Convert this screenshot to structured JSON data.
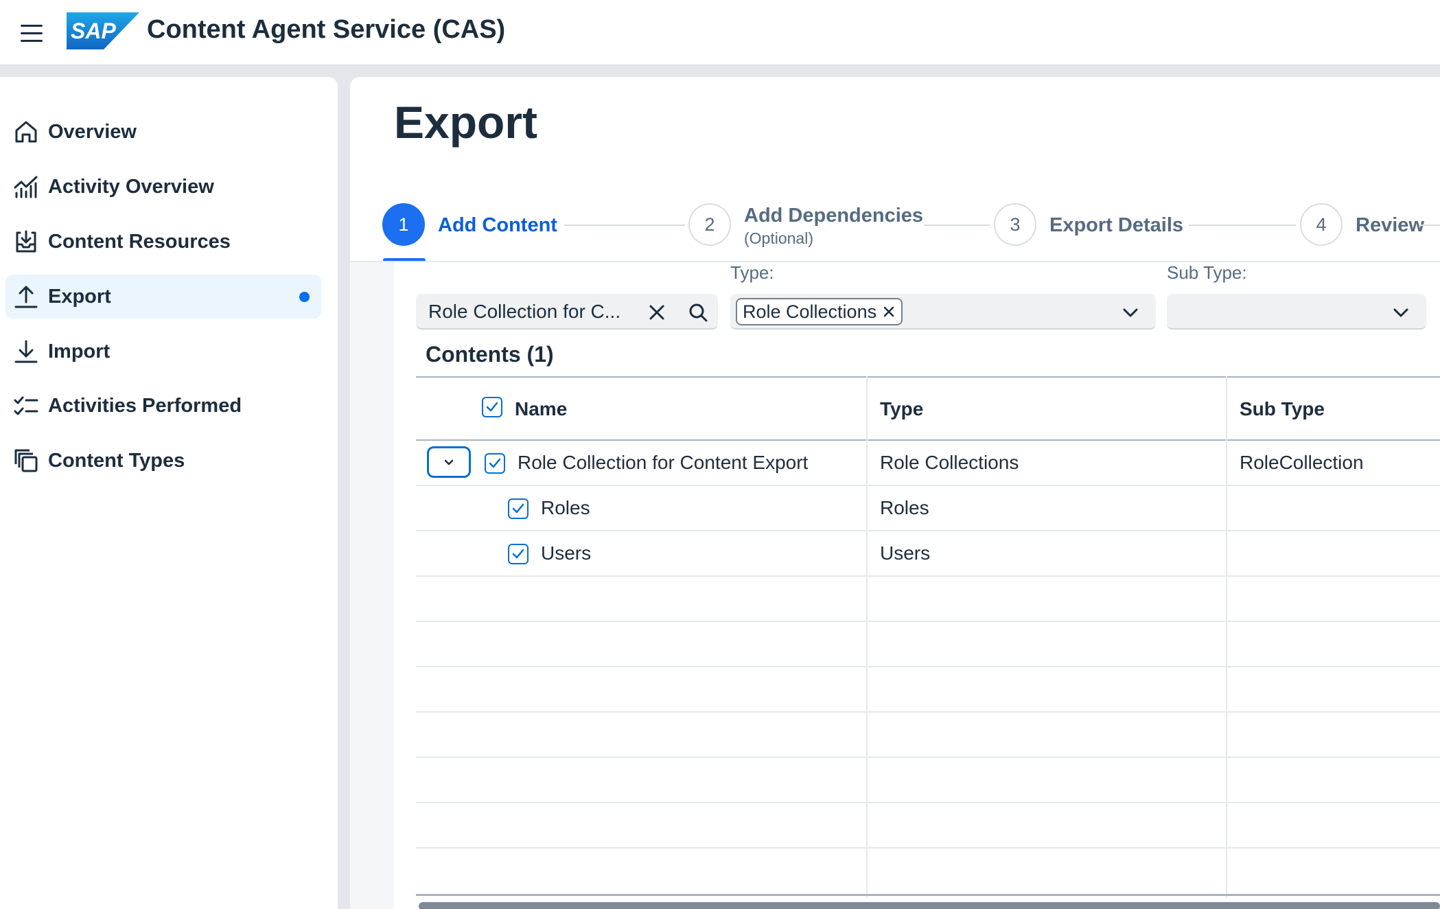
{
  "shell": {
    "title": "Content Agent Service (CAS)",
    "logo_text": "SAP"
  },
  "nav": {
    "items": [
      {
        "label": "Overview",
        "icon": "home-icon"
      },
      {
        "label": "Activity Overview",
        "icon": "activity-chart-icon"
      },
      {
        "label": "Content Resources",
        "icon": "inbox-download-icon"
      },
      {
        "label": "Export",
        "icon": "upload-icon",
        "selected": true
      },
      {
        "label": "Import",
        "icon": "download-icon"
      },
      {
        "label": "Activities Performed",
        "icon": "task-list-icon"
      },
      {
        "label": "Content Types",
        "icon": "stacked-pages-icon"
      }
    ]
  },
  "page": {
    "title": "Export"
  },
  "wizard": {
    "steps": [
      {
        "number": "1",
        "label": "Add Content",
        "active": true
      },
      {
        "number": "2",
        "label": "Add Dependencies",
        "sublabel": "(Optional)"
      },
      {
        "number": "3",
        "label": "Export Details"
      },
      {
        "number": "4",
        "label": "Review"
      }
    ]
  },
  "filters": {
    "search_value": "Role Collection for C...",
    "type_label": "Type:",
    "type_token": "Role Collections",
    "subtype_label": "Sub Type:"
  },
  "table": {
    "title": "Contents (1)",
    "columns": [
      "Name",
      "Type",
      "Sub Type"
    ],
    "rows": [
      {
        "name": "Role Collection for Content Export",
        "type": "Role Collections",
        "subtype": "RoleCollection",
        "checked": true,
        "level": 0
      },
      {
        "name": "Roles",
        "type": "Roles",
        "subtype": "",
        "checked": true,
        "level": 1
      },
      {
        "name": "Users",
        "type": "Users",
        "subtype": "",
        "checked": true,
        "level": 1
      }
    ]
  },
  "colors": {
    "accent": "#0a6ed1",
    "active_step": "#1b6ff0",
    "text": "#1d2d3e",
    "selected_nav_bg": "#eaf5fe",
    "logo_blue": "#1a73c9"
  }
}
